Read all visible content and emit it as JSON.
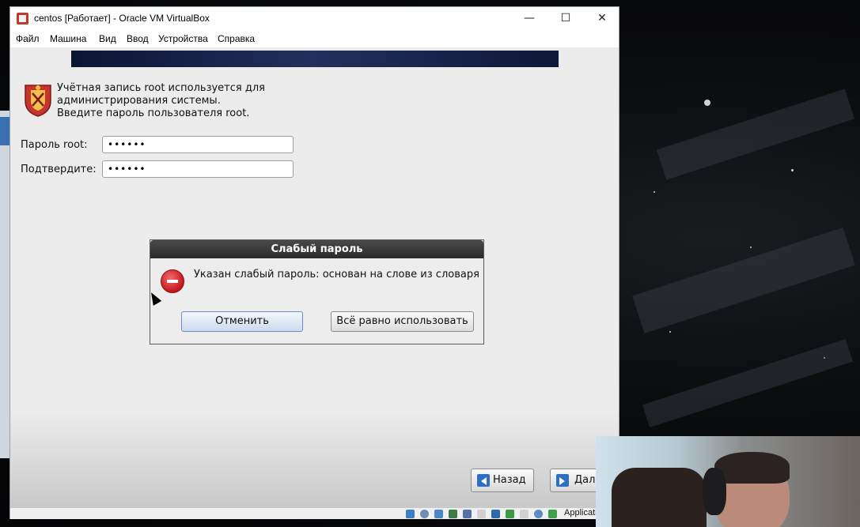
{
  "window": {
    "title": "centos [Работает] - Oracle VM VirtualBox",
    "minimize": "—",
    "maximize": "☐",
    "close": "✕"
  },
  "menu": [
    "Файл",
    "Машина",
    "Вид",
    "Ввод",
    "Устройства",
    "Справка"
  ],
  "installer": {
    "info_lines": [
      "Учётная запись root используется для",
      "администрирования системы.",
      "Введите пароль пользователя root."
    ],
    "root_password_label": "Пароль root:",
    "root_password_value": "••••••",
    "confirm_label": "Подтвердите:",
    "confirm_value": "••••••",
    "back_button": "Назад",
    "next_button": "Дал"
  },
  "dialog": {
    "title": "Слабый пароль",
    "message": "Указан слабый пароль: основан на слове из словаря",
    "cancel_button": "Отменить",
    "use_anyway_button": "Всё равно использовать"
  },
  "statusbar": {
    "text": "Applicati"
  },
  "colors": {
    "banner": "#0b1433",
    "dialog_title_bg": "#2b2b2b",
    "error_red": "#c4161c",
    "nav_arrow_blue": "#2d6fc2"
  }
}
